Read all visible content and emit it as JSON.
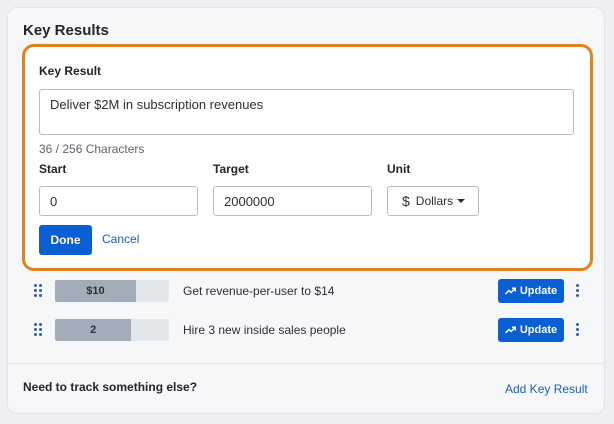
{
  "card": {
    "title": "Key Results"
  },
  "editor": {
    "label": "Key Result",
    "value": "Deliver $2M in subscription revenues",
    "char_count": "36 / 256 Characters",
    "start": {
      "label": "Start",
      "value": "0"
    },
    "target": {
      "label": "Target",
      "value": "2000000"
    },
    "unit": {
      "label": "Unit",
      "symbol": "$",
      "selected": "Dollars"
    },
    "done_label": "Done",
    "cancel_label": "Cancel"
  },
  "key_results": [
    {
      "progress_label": "$10",
      "progress_fraction": 0.71,
      "text": "Get revenue-per-user to $14",
      "update_label": "Update"
    },
    {
      "progress_label": "2",
      "progress_fraction": 0.67,
      "text": "Hire 3 new inside sales people",
      "update_label": "Update"
    }
  ],
  "footer": {
    "prompt": "Need to track something else?",
    "add_label": "Add Key Result"
  },
  "colors": {
    "accent": "#0a5fd3",
    "focus_border": "#e2821f",
    "link": "#1a5fbf"
  }
}
